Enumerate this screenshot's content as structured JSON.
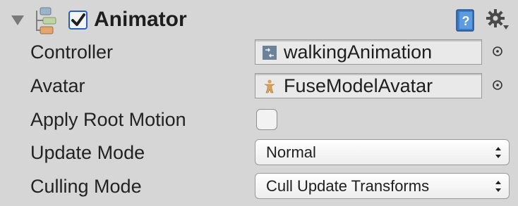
{
  "component": {
    "title": "Animator",
    "enabled": true,
    "icons": [
      "foldout-arrow-icon",
      "animator-component-icon",
      "help-book-icon",
      "gear-icon"
    ]
  },
  "fields": {
    "controller": {
      "label": "Controller",
      "value": "walkingAnimation",
      "icon": "animator-controller-icon"
    },
    "avatar": {
      "label": "Avatar",
      "value": "FuseModelAvatar",
      "icon": "avatar-figure-icon"
    },
    "apply_root_motion": {
      "label": "Apply Root Motion",
      "checked": false
    },
    "update_mode": {
      "label": "Update Mode",
      "value": "Normal"
    },
    "culling_mode": {
      "label": "Culling Mode",
      "value": "Cull Update Transforms"
    }
  },
  "colors": {
    "background": "#d6d6d6",
    "checkbox_accent": "#2b5fbf"
  }
}
